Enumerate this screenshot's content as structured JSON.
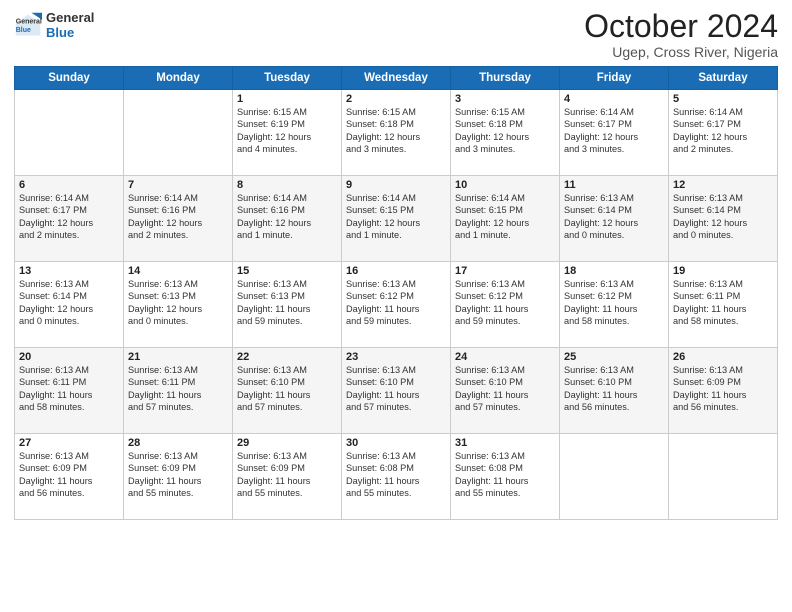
{
  "header": {
    "logo_line1": "General",
    "logo_line2": "Blue",
    "month_title": "October 2024",
    "location": "Ugep, Cross River, Nigeria"
  },
  "days_of_week": [
    "Sunday",
    "Monday",
    "Tuesday",
    "Wednesday",
    "Thursday",
    "Friday",
    "Saturday"
  ],
  "weeks": [
    [
      {
        "day": "",
        "info": ""
      },
      {
        "day": "",
        "info": ""
      },
      {
        "day": "1",
        "info": "Sunrise: 6:15 AM\nSunset: 6:19 PM\nDaylight: 12 hours\nand 4 minutes."
      },
      {
        "day": "2",
        "info": "Sunrise: 6:15 AM\nSunset: 6:18 PM\nDaylight: 12 hours\nand 3 minutes."
      },
      {
        "day": "3",
        "info": "Sunrise: 6:15 AM\nSunset: 6:18 PM\nDaylight: 12 hours\nand 3 minutes."
      },
      {
        "day": "4",
        "info": "Sunrise: 6:14 AM\nSunset: 6:17 PM\nDaylight: 12 hours\nand 3 minutes."
      },
      {
        "day": "5",
        "info": "Sunrise: 6:14 AM\nSunset: 6:17 PM\nDaylight: 12 hours\nand 2 minutes."
      }
    ],
    [
      {
        "day": "6",
        "info": "Sunrise: 6:14 AM\nSunset: 6:17 PM\nDaylight: 12 hours\nand 2 minutes."
      },
      {
        "day": "7",
        "info": "Sunrise: 6:14 AM\nSunset: 6:16 PM\nDaylight: 12 hours\nand 2 minutes."
      },
      {
        "day": "8",
        "info": "Sunrise: 6:14 AM\nSunset: 6:16 PM\nDaylight: 12 hours\nand 1 minute."
      },
      {
        "day": "9",
        "info": "Sunrise: 6:14 AM\nSunset: 6:15 PM\nDaylight: 12 hours\nand 1 minute."
      },
      {
        "day": "10",
        "info": "Sunrise: 6:14 AM\nSunset: 6:15 PM\nDaylight: 12 hours\nand 1 minute."
      },
      {
        "day": "11",
        "info": "Sunrise: 6:13 AM\nSunset: 6:14 PM\nDaylight: 12 hours\nand 0 minutes."
      },
      {
        "day": "12",
        "info": "Sunrise: 6:13 AM\nSunset: 6:14 PM\nDaylight: 12 hours\nand 0 minutes."
      }
    ],
    [
      {
        "day": "13",
        "info": "Sunrise: 6:13 AM\nSunset: 6:14 PM\nDaylight: 12 hours\nand 0 minutes."
      },
      {
        "day": "14",
        "info": "Sunrise: 6:13 AM\nSunset: 6:13 PM\nDaylight: 12 hours\nand 0 minutes."
      },
      {
        "day": "15",
        "info": "Sunrise: 6:13 AM\nSunset: 6:13 PM\nDaylight: 11 hours\nand 59 minutes."
      },
      {
        "day": "16",
        "info": "Sunrise: 6:13 AM\nSunset: 6:12 PM\nDaylight: 11 hours\nand 59 minutes."
      },
      {
        "day": "17",
        "info": "Sunrise: 6:13 AM\nSunset: 6:12 PM\nDaylight: 11 hours\nand 59 minutes."
      },
      {
        "day": "18",
        "info": "Sunrise: 6:13 AM\nSunset: 6:12 PM\nDaylight: 11 hours\nand 58 minutes."
      },
      {
        "day": "19",
        "info": "Sunrise: 6:13 AM\nSunset: 6:11 PM\nDaylight: 11 hours\nand 58 minutes."
      }
    ],
    [
      {
        "day": "20",
        "info": "Sunrise: 6:13 AM\nSunset: 6:11 PM\nDaylight: 11 hours\nand 58 minutes."
      },
      {
        "day": "21",
        "info": "Sunrise: 6:13 AM\nSunset: 6:11 PM\nDaylight: 11 hours\nand 57 minutes."
      },
      {
        "day": "22",
        "info": "Sunrise: 6:13 AM\nSunset: 6:10 PM\nDaylight: 11 hours\nand 57 minutes."
      },
      {
        "day": "23",
        "info": "Sunrise: 6:13 AM\nSunset: 6:10 PM\nDaylight: 11 hours\nand 57 minutes."
      },
      {
        "day": "24",
        "info": "Sunrise: 6:13 AM\nSunset: 6:10 PM\nDaylight: 11 hours\nand 57 minutes."
      },
      {
        "day": "25",
        "info": "Sunrise: 6:13 AM\nSunset: 6:10 PM\nDaylight: 11 hours\nand 56 minutes."
      },
      {
        "day": "26",
        "info": "Sunrise: 6:13 AM\nSunset: 6:09 PM\nDaylight: 11 hours\nand 56 minutes."
      }
    ],
    [
      {
        "day": "27",
        "info": "Sunrise: 6:13 AM\nSunset: 6:09 PM\nDaylight: 11 hours\nand 56 minutes."
      },
      {
        "day": "28",
        "info": "Sunrise: 6:13 AM\nSunset: 6:09 PM\nDaylight: 11 hours\nand 55 minutes."
      },
      {
        "day": "29",
        "info": "Sunrise: 6:13 AM\nSunset: 6:09 PM\nDaylight: 11 hours\nand 55 minutes."
      },
      {
        "day": "30",
        "info": "Sunrise: 6:13 AM\nSunset: 6:08 PM\nDaylight: 11 hours\nand 55 minutes."
      },
      {
        "day": "31",
        "info": "Sunrise: 6:13 AM\nSunset: 6:08 PM\nDaylight: 11 hours\nand 55 minutes."
      },
      {
        "day": "",
        "info": ""
      },
      {
        "day": "",
        "info": ""
      }
    ]
  ]
}
